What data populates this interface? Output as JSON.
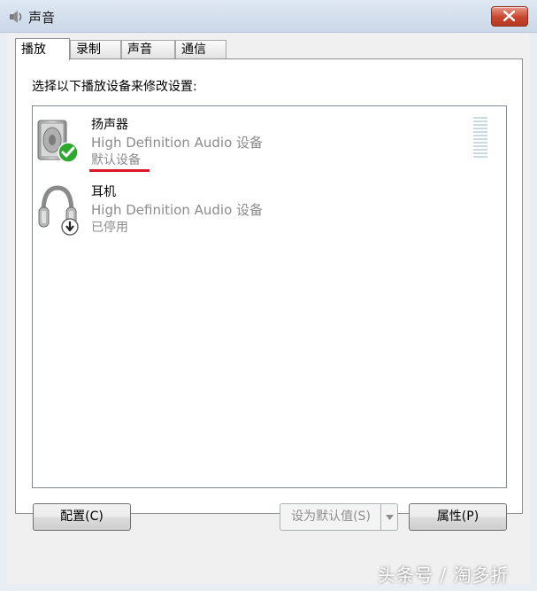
{
  "window": {
    "title": "声音",
    "title_icon": "speaker-icon"
  },
  "tabs": [
    {
      "label": "播放",
      "active": true
    },
    {
      "label": "录制",
      "active": false
    },
    {
      "label": "声音",
      "active": false
    },
    {
      "label": "通信",
      "active": false
    }
  ],
  "instruction": "选择以下播放设备来修改设置:",
  "devices": [
    {
      "name": "扬声器",
      "description": "High Definition Audio 设备",
      "status": "默认设备",
      "icon": "speaker-icon",
      "badge": "check-icon"
    },
    {
      "name": "耳机",
      "description": "High Definition Audio 设备",
      "status": "已停用",
      "icon": "headphones-icon",
      "badge": "down-arrow-icon"
    }
  ],
  "buttons": {
    "configure": "配置(C)",
    "set_default": "设为默认值(S)",
    "properties": "属性(P)"
  },
  "watermark": "头条号 / 淘多折",
  "colors": {
    "highlight": "#d9182a",
    "check": "#2fa82f"
  }
}
